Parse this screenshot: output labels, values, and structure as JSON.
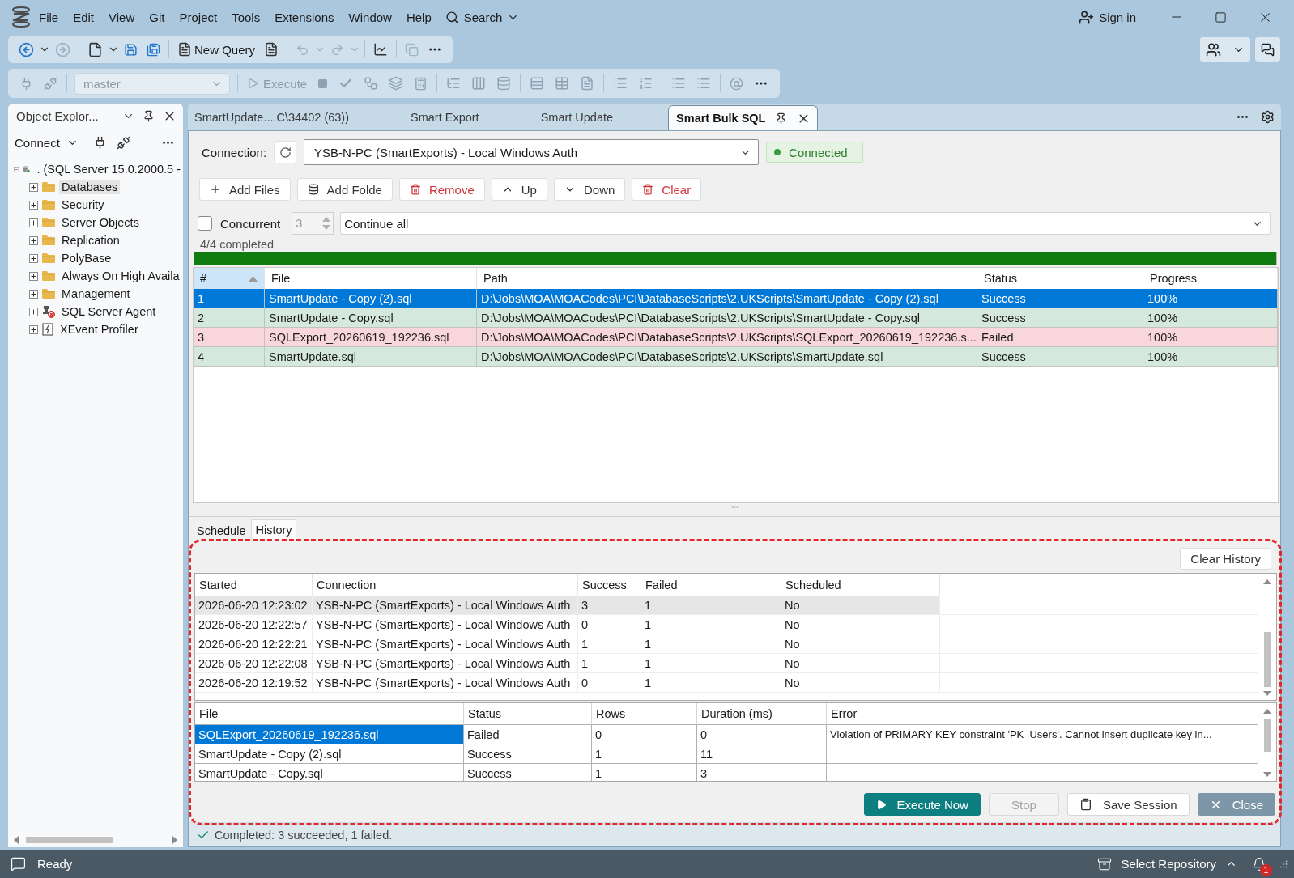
{
  "menu_bar": {
    "items": [
      "File",
      "Edit",
      "View",
      "Git",
      "Project",
      "Tools",
      "Extensions",
      "Window",
      "Help"
    ],
    "search": "Search",
    "sign_in": "Sign in"
  },
  "standard_toolbar": {
    "new_query": "New Query"
  },
  "query_toolbar": {
    "database": "master",
    "execute": "Execute",
    "disabled": true
  },
  "object_explorer": {
    "title": "Object Explor...",
    "connect": "Connect",
    "tree": [
      {
        "label": ". (SQL Server 15.0.2000.5 -",
        "kind": "server",
        "expanded": true,
        "selected": false,
        "children": [
          {
            "label": "Databases",
            "kind": "folder",
            "expanded": false,
            "selected": true
          },
          {
            "label": "Security",
            "kind": "folder",
            "expanded": false,
            "selected": false
          },
          {
            "label": "Server Objects",
            "kind": "folder",
            "expanded": false,
            "selected": false
          },
          {
            "label": "Replication",
            "kind": "folder",
            "expanded": false,
            "selected": false
          },
          {
            "label": "PolyBase",
            "kind": "folder",
            "expanded": false,
            "selected": false
          },
          {
            "label": "Always On High Availa",
            "kind": "folder",
            "expanded": false,
            "selected": false
          },
          {
            "label": "Management",
            "kind": "folder",
            "expanded": false,
            "selected": false
          },
          {
            "label": "SQL Server Agent",
            "kind": "agent",
            "expanded": false,
            "selected": false
          },
          {
            "label": "XEvent Profiler",
            "kind": "profiler",
            "expanded": false,
            "selected": false
          }
        ]
      }
    ]
  },
  "document_tabs": [
    {
      "label": "SmartUpdate....C\\34402 (63))",
      "selected": false
    },
    {
      "label": "Smart Export",
      "selected": false
    },
    {
      "label": "Smart Update",
      "selected": false
    },
    {
      "label": "Smart Bulk SQL",
      "selected": true
    }
  ],
  "connection": {
    "label": "Connection:",
    "value": "YSB-N-PC (SmartExports) - Local Windows Auth",
    "status": "Connected"
  },
  "file_buttons": [
    {
      "label": "Add Files",
      "kind": "add"
    },
    {
      "label": "Add Folde",
      "kind": "add-folder"
    },
    {
      "label": "Remove",
      "kind": "remove"
    },
    {
      "label": "Up",
      "kind": "move-up"
    },
    {
      "label": "Down",
      "kind": "move-down"
    },
    {
      "label": "Clear",
      "kind": "clear"
    }
  ],
  "concurrent": {
    "label": "Concurrent",
    "checked": false,
    "count": "3",
    "disabled": true
  },
  "error_mode": "Continue all",
  "progress": {
    "text": "4/4 completed",
    "level": 1
  },
  "files_table": {
    "columns": [
      {
        "label": "#",
        "sorted": true
      },
      {
        "label": "File",
        "sorted": false
      },
      {
        "label": "Path",
        "sorted": false
      },
      {
        "label": "Status",
        "sorted": false
      },
      {
        "label": "Progress",
        "sorted": false
      }
    ],
    "rows": [
      {
        "cells": [
          "1",
          "SmartUpdate - Copy (2).sql",
          "D:\\Jobs\\MOA\\MOACodes\\PCI\\DatabaseScripts\\2.UKScripts\\SmartUpdate - Copy (2).sql",
          "Success",
          "100%"
        ],
        "kind": "success",
        "selected": true
      },
      {
        "cells": [
          "2",
          "SmartUpdate - Copy.sql",
          "D:\\Jobs\\MOA\\MOACodes\\PCI\\DatabaseScripts\\2.UKScripts\\SmartUpdate - Copy.sql",
          "Success",
          "100%"
        ],
        "kind": "success",
        "selected": false
      },
      {
        "cells": [
          "3",
          "SQLExport_20260619_192236.sql",
          "D:\\Jobs\\MOA\\MOACodes\\PCI\\DatabaseScripts\\2.UKScripts\\SQLExport_20260619_192236.s...",
          "Failed",
          "100%"
        ],
        "kind": "failed",
        "selected": false
      },
      {
        "cells": [
          "4",
          "SmartUpdate.sql",
          "D:\\Jobs\\MOA\\MOACodes\\PCI\\DatabaseScripts\\2.UKScripts\\SmartUpdate.sql",
          "Success",
          "100%"
        ],
        "kind": "success",
        "selected": false
      }
    ]
  },
  "bottom_tabs": [
    {
      "label": "Schedule",
      "selected": false
    },
    {
      "label": "History",
      "selected": true
    }
  ],
  "history": {
    "clear_button": "Clear History",
    "columns": [
      "Started",
      "Connection",
      "Success",
      "Failed",
      "Scheduled"
    ],
    "rows": [
      {
        "cells": [
          "2026-06-20 12:23:02",
          "YSB-N-PC (SmartExports) - Local Windows Auth",
          "3",
          "1",
          "No"
        ],
        "selected": true
      },
      {
        "cells": [
          "2026-06-20 12:22:57",
          "YSB-N-PC (SmartExports) - Local Windows Auth",
          "0",
          "1",
          "No"
        ],
        "selected": false
      },
      {
        "cells": [
          "2026-06-20 12:22:21",
          "YSB-N-PC (SmartExports) - Local Windows Auth",
          "1",
          "1",
          "No"
        ],
        "selected": false
      },
      {
        "cells": [
          "2026-06-20 12:22:08",
          "YSB-N-PC (SmartExports) - Local Windows Auth",
          "1",
          "1",
          "No"
        ],
        "selected": false
      },
      {
        "cells": [
          "2026-06-20 12:19:52",
          "YSB-N-PC (SmartExports) - Local Windows Auth",
          "0",
          "1",
          "No"
        ],
        "selected": false
      }
    ]
  },
  "history_details": {
    "columns": [
      "File",
      "Status",
      "Rows",
      "Duration (ms)",
      "Error"
    ],
    "rows": [
      {
        "cells": [
          "SQLExport_20260619_192236.sql",
          "Failed",
          "0",
          "0",
          "Violation of PRIMARY KEY constraint 'PK_Users'. Cannot insert duplicate key in..."
        ],
        "selected": true
      },
      {
        "cells": [
          "SmartUpdate - Copy (2).sql",
          "Success",
          "1",
          "11"
        ],
        "selected": false
      },
      {
        "cells": [
          "SmartUpdate - Copy.sql",
          "Success",
          "1",
          "3"
        ],
        "selected": false
      }
    ]
  },
  "actions": [
    {
      "label": "Execute Now",
      "kind": "execute",
      "disabled": false
    },
    {
      "label": "Stop",
      "kind": "stop",
      "disabled": true
    },
    {
      "label": "Save Session",
      "kind": "save",
      "disabled": false
    },
    {
      "label": "Close",
      "kind": "close",
      "disabled": false
    }
  ],
  "result": {
    "text": "Completed: 3 succeeded, 1 failed."
  },
  "status_bar": {
    "text": "Ready",
    "repository": "Select Repository",
    "notification_count": "1"
  }
}
